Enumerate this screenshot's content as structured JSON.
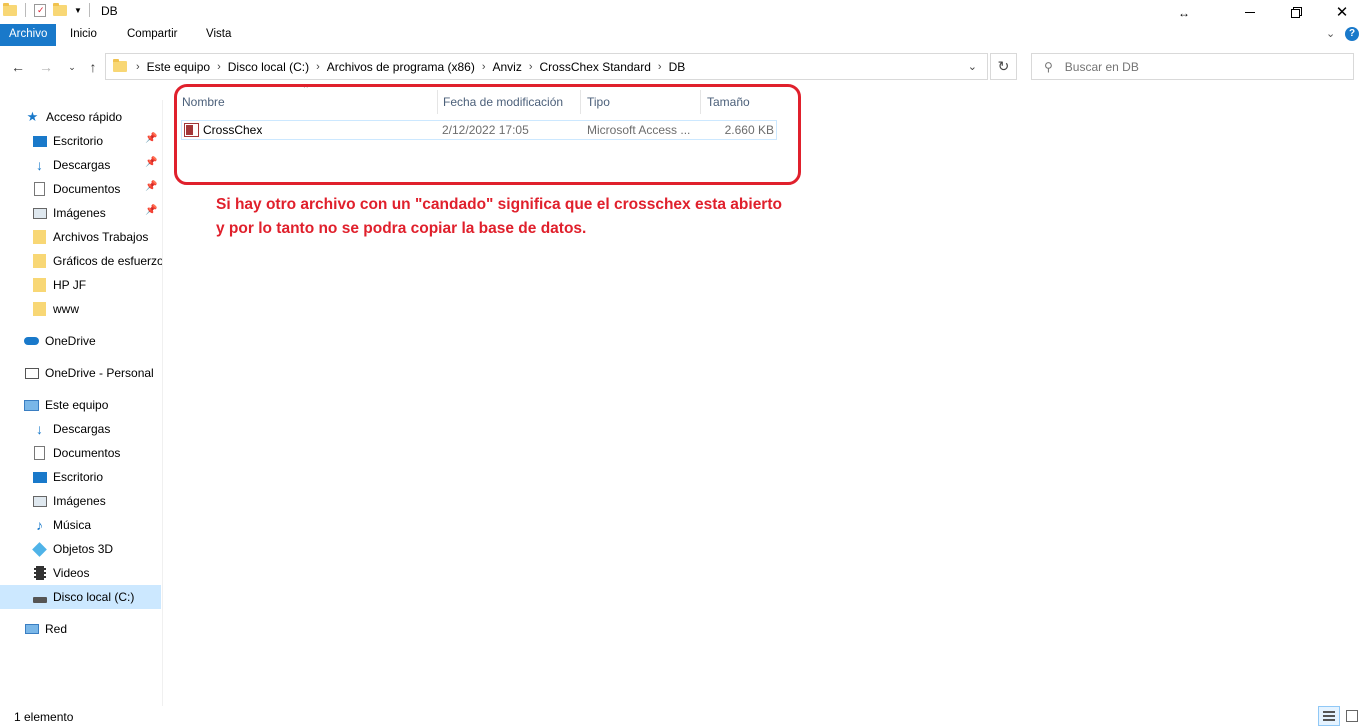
{
  "window": {
    "title": "DB",
    "resize_cursor": "↔"
  },
  "ribbon": {
    "tabs": [
      "Archivo",
      "Inicio",
      "Compartir",
      "Vista"
    ]
  },
  "address_bar": {
    "crumbs": [
      "Este equipo",
      "Disco local (C:)",
      "Archivos de programa (x86)",
      "Anviz",
      "CrossChex Standard",
      "DB"
    ],
    "search_placeholder": "Buscar en DB"
  },
  "navigation": {
    "quick_access": {
      "label": "Acceso rápido",
      "items": [
        "Escritorio",
        "Descargas",
        "Documentos",
        "Imágenes",
        "Archivos Trabajos",
        "Gráficos de esfuerzos",
        "HP JF",
        "www"
      ]
    },
    "onedrive": "OneDrive",
    "onedrive_personal": "OneDrive - Personal",
    "this_pc": {
      "label": "Este equipo",
      "items": [
        "Descargas",
        "Documentos",
        "Escritorio",
        "Imágenes",
        "Música",
        "Objetos 3D",
        "Videos",
        "Disco local (C:)"
      ]
    },
    "network": "Red"
  },
  "file_list": {
    "columns": [
      "Nombre",
      "Fecha de modificación",
      "Tipo",
      "Tamaño"
    ],
    "files": [
      {
        "name": "CrossChex",
        "modified": "2/12/2022 17:05",
        "type": "Microsoft Access ...",
        "size": "2.660 KB"
      }
    ]
  },
  "annotation": {
    "text": "Si hay otro archivo con un \"candado\" significa que el crosschex esta abierto\ny por lo tanto no se podra copiar la base de datos.",
    "color": "#e0202c"
  },
  "status_bar": {
    "text": "1 elemento"
  },
  "colors": {
    "accent": "#1979ca",
    "selection": "#cce8ff",
    "folder": "#f8d775"
  }
}
